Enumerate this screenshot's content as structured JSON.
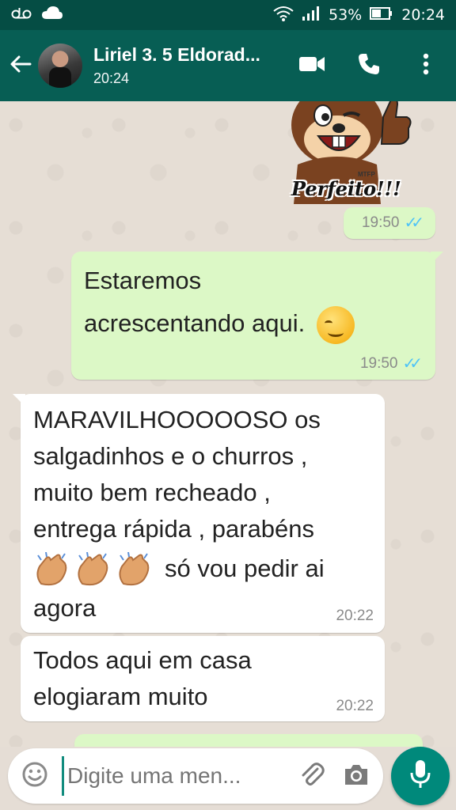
{
  "status_bar": {
    "left_icons": [
      "voicemail-icon",
      "cloud-icon"
    ],
    "battery_percent": "53%",
    "time": "20:24"
  },
  "header": {
    "contact_name": "Liriel 3. 5 Eldorad...",
    "contact_status": "20:24",
    "icons": [
      "back-arrow-icon",
      "video-call-icon",
      "phone-icon",
      "more-options-icon"
    ]
  },
  "chat": {
    "sticker": {
      "caption": "Perfeito!!!",
      "mini_label": "MTFP",
      "time": "19:50"
    },
    "messages": [
      {
        "direction": "out",
        "line1": "Estaremos",
        "line2": "acrescentando aqui.",
        "emoji": "smirking-face",
        "time": "19:50",
        "status": "read"
      },
      {
        "direction": "in",
        "lines": [
          "MARAVILHOOOOOSO os",
          "salgadinhos e o churros ,",
          "muito bem recheado ,",
          "entrega rápida , parabéns"
        ],
        "clap_count": 3,
        "tail_text": "só vou pedir ai",
        "last_line": "agora",
        "time": "20:22"
      },
      {
        "direction": "in",
        "lines": [
          "Todos aqui em casa",
          "elogiaram muito"
        ],
        "time": "20:22"
      }
    ]
  },
  "composer": {
    "placeholder": "Digite uma men...",
    "icons": [
      "emoji-icon",
      "attach-icon",
      "camera-icon",
      "mic-icon"
    ]
  },
  "colors": {
    "header": "#075e54",
    "status_bar": "#054d44",
    "outgoing_bubble": "#dcf8c6",
    "incoming_bubble": "#ffffff",
    "read_ticks": "#4fc3f7",
    "mic_button": "#00897b"
  }
}
